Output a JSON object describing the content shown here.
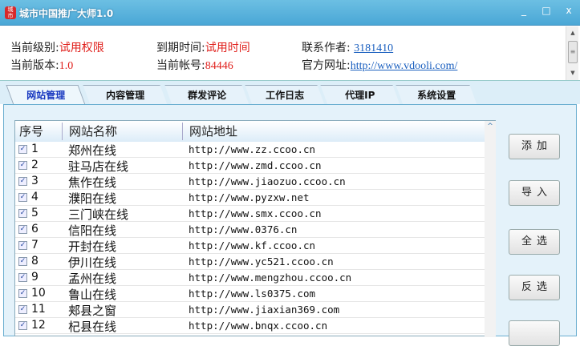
{
  "window": {
    "title": "城市中国推广大师1.0",
    "minimize": "_",
    "maximize": "□",
    "close": "x",
    "logo_text": "城市"
  },
  "info": {
    "level_label": "当前级别:",
    "level_value": "试用权限",
    "expire_label": "到期时间:",
    "expire_value": "试用时间",
    "contact_label": "联系作者:",
    "contact_value": "3181410",
    "version_label": "当前版本:",
    "version_value": "1.0",
    "account_label": "当前帐号:",
    "account_value": "84446",
    "site_label": "官方网址:",
    "site_value": "http://www.vdooli.com/"
  },
  "tabs": [
    "网站管理",
    "内容管理",
    "群发评论",
    "工作日志",
    "代理IP",
    "系统设置"
  ],
  "list": {
    "headers": [
      "序号",
      "网站名称",
      "网站地址"
    ],
    "rows": [
      {
        "n": "1",
        "name": "郑州在线",
        "url": "http://www.zz.ccoo.cn"
      },
      {
        "n": "2",
        "name": "驻马店在线",
        "url": "http://www.zmd.ccoo.cn"
      },
      {
        "n": "3",
        "name": "焦作在线",
        "url": "http://www.jiaozuo.ccoo.cn"
      },
      {
        "n": "4",
        "name": "濮阳在线",
        "url": "http://www.pyzxw.net"
      },
      {
        "n": "5",
        "name": "三门峡在线",
        "url": "http://www.smx.ccoo.cn"
      },
      {
        "n": "6",
        "name": "信阳在线",
        "url": "http://www.0376.cn"
      },
      {
        "n": "7",
        "name": "开封在线",
        "url": "http://www.kf.ccoo.cn"
      },
      {
        "n": "8",
        "name": "伊川在线",
        "url": "http://www.yc521.ccoo.cn"
      },
      {
        "n": "9",
        "name": "孟州在线",
        "url": "http://www.mengzhou.ccoo.cn"
      },
      {
        "n": "10",
        "name": "鲁山在线",
        "url": "http://www.ls0375.com"
      },
      {
        "n": "11",
        "name": "郏县之窗",
        "url": "http://www.jiaxian369.com"
      },
      {
        "n": "12",
        "name": "杞县在线",
        "url": "http://www.bnqx.ccoo.cn"
      }
    ]
  },
  "buttons": [
    "添加",
    "导入",
    "全选",
    "反选"
  ]
}
